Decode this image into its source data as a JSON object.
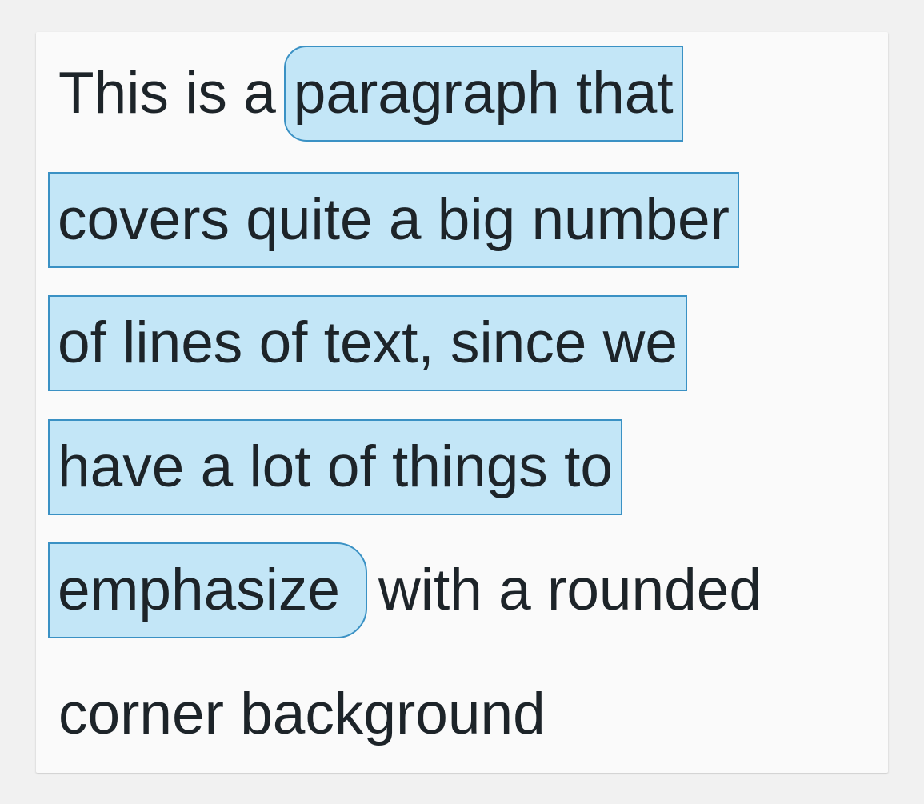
{
  "paragraph": {
    "before_highlight": "This is a",
    "highlight_lines": [
      "paragraph that",
      "covers quite a big number",
      "of lines of text, since we",
      "have a lot of things to",
      "emphasize"
    ],
    "after_highlight_same_line": "with a rounded",
    "trailing_line": "corner background"
  },
  "colors": {
    "highlight_fill": "#c3e6f7",
    "highlight_border": "#3a91c4",
    "text": "#1d2429",
    "card_background": "#fafafa"
  }
}
